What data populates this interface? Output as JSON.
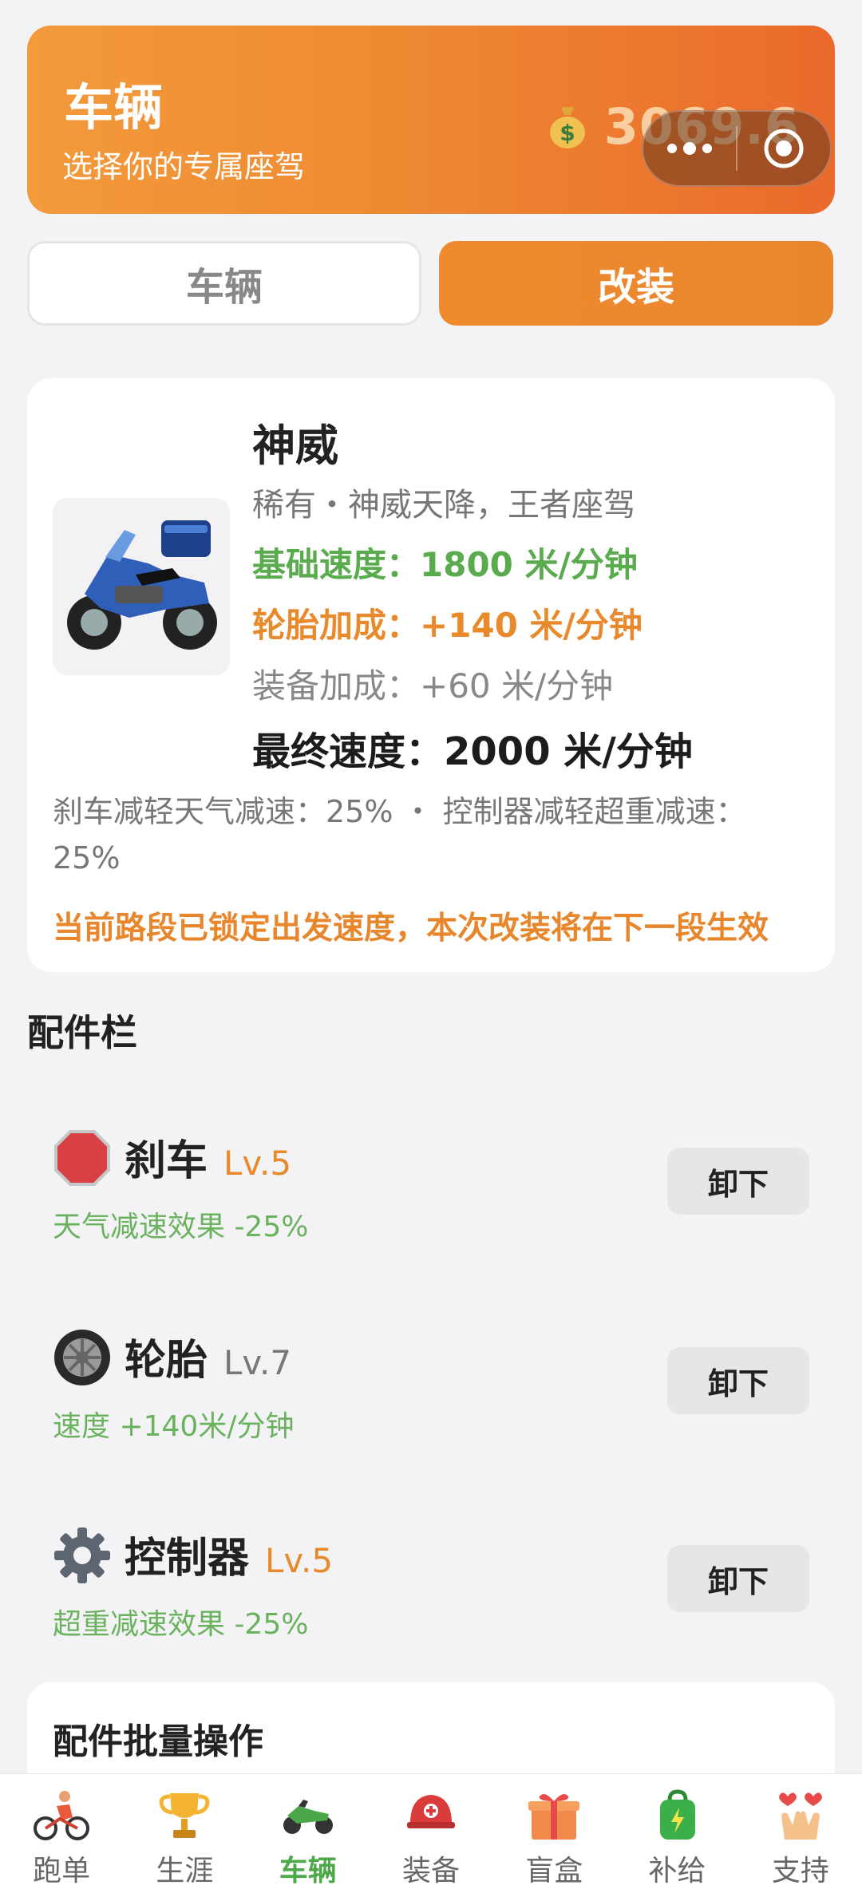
{
  "header": {
    "title": "车辆",
    "subtitle": "选择你的专属座驾",
    "coins": "3069.6",
    "coin_icon": "money-bag-icon"
  },
  "tabs": [
    {
      "label": "车辆",
      "active": false
    },
    {
      "label": "改装",
      "active": true
    }
  ],
  "vehicle": {
    "name": "神威",
    "description": "稀有・神威天降，王者座驾",
    "base_speed": "基础速度：1800 米/分钟",
    "tire_bonus": "轮胎加成：+140 米/分钟",
    "equip_bonus": "装备加成：+60 米/分钟",
    "final_speed": "最终速度：2000 米/分钟",
    "reductions": "刹车减轻天气减速：25% ・ 控制器减轻超重减速：25%",
    "warning": "当前路段已锁定出发速度，本次改装将在下一段生效"
  },
  "parts_section": {
    "title": "配件栏",
    "parts": [
      {
        "name": "刹车",
        "level": "Lv.5",
        "effect": "天气减速效果 -25%",
        "button": "卸下",
        "icon": "stop-sign-icon"
      },
      {
        "name": "轮胎",
        "level": "Lv.7",
        "effect": "速度 +140米/分钟",
        "button": "卸下",
        "icon": "tire-icon"
      },
      {
        "name": "控制器",
        "level": "Lv.5",
        "effect": "超重减速效果 -25%",
        "button": "卸下",
        "icon": "gear-icon"
      }
    ]
  },
  "batch": {
    "title": "配件批量操作"
  },
  "bottom_nav": [
    {
      "label": "跑单",
      "icon": "cyclist-icon",
      "active": false
    },
    {
      "label": "生涯",
      "icon": "trophy-icon",
      "active": false
    },
    {
      "label": "车辆",
      "icon": "motorcycle-icon",
      "active": true
    },
    {
      "label": "装备",
      "icon": "helmet-icon",
      "active": false
    },
    {
      "label": "盲盒",
      "icon": "gift-box-icon",
      "active": false
    },
    {
      "label": "补给",
      "icon": "backpack-icon",
      "active": false
    },
    {
      "label": "支持",
      "icon": "heart-hands-icon",
      "active": false
    }
  ],
  "colors": {
    "accent_orange": "#ee8a32",
    "green": "#5aaa4e",
    "warning_orange": "#e8862c"
  }
}
